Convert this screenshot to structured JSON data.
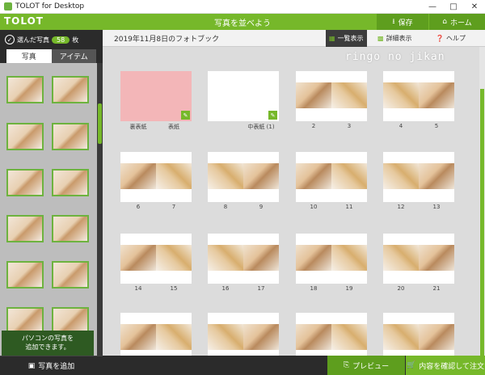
{
  "window": {
    "title": "TOLOT for Desktop"
  },
  "header": {
    "logo": "TOLOT",
    "title": "写真を並べよう",
    "save_label": "保存",
    "home_label": "ホーム"
  },
  "sidebar": {
    "selected_label": "選んだ写真",
    "selected_count": "58",
    "count_unit": "枚",
    "tabs": [
      "写真",
      "アイテム"
    ],
    "tip_line1": "パソコンの写真を",
    "tip_line2": "追加できます。",
    "add_label": "写真を追加"
  },
  "toolbar": {
    "book_title": "2019年11月8日のフォトブック",
    "list_view_label": "一覧表示",
    "detail_view_label": "詳細表示",
    "help_label": "ヘルプ"
  },
  "watermark": "ringo no jikan",
  "spreads": [
    {
      "left_label": "裏表紙",
      "right_label": "表紙"
    },
    {
      "left_label": "",
      "right_label": "中表紙 (1)"
    },
    {
      "left_label": "2",
      "right_label": "3"
    },
    {
      "left_label": "4",
      "right_label": "5"
    },
    {
      "left_label": "6",
      "right_label": "7"
    },
    {
      "left_label": "8",
      "right_label": "9"
    },
    {
      "left_label": "10",
      "right_label": "11"
    },
    {
      "left_label": "12",
      "right_label": "13"
    },
    {
      "left_label": "14",
      "right_label": "15"
    },
    {
      "left_label": "16",
      "right_label": "17"
    },
    {
      "left_label": "18",
      "right_label": "19"
    },
    {
      "left_label": "20",
      "right_label": "21"
    },
    {
      "left_label": "",
      "right_label": ""
    },
    {
      "left_label": "",
      "right_label": ""
    },
    {
      "left_label": "",
      "right_label": ""
    },
    {
      "left_label": "",
      "right_label": ""
    }
  ],
  "footer": {
    "preview_label": "プレビュー",
    "confirm_label": "内容を確認して注文"
  }
}
